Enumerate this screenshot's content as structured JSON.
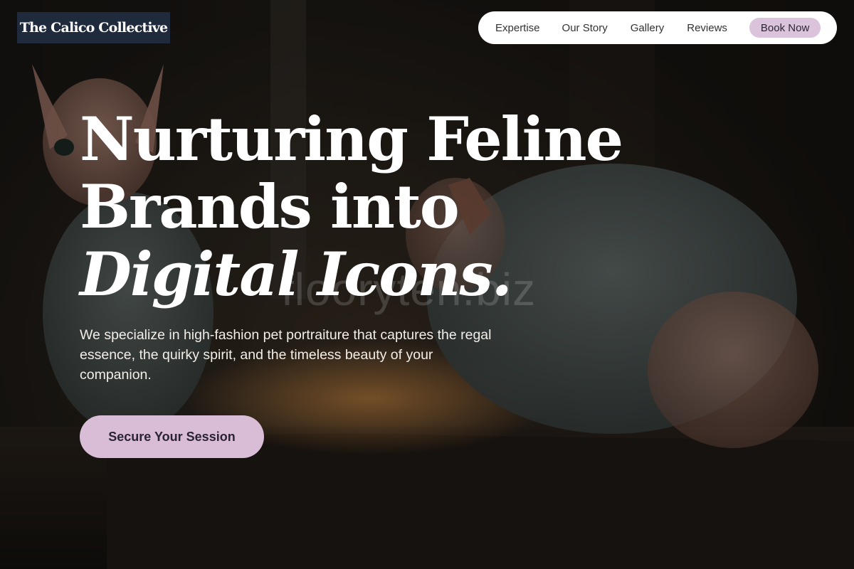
{
  "brand": {
    "logo_text": "The Calico Collective",
    "logo_bg": "#1f2a3c"
  },
  "nav": {
    "links": [
      {
        "label": "Expertise"
      },
      {
        "label": "Our Story"
      },
      {
        "label": "Gallery"
      },
      {
        "label": "Reviews"
      }
    ],
    "cta_label": "Book Now",
    "cta_color": "#dcc3dc"
  },
  "hero": {
    "title_line1": "Nurturing Feline",
    "title_line2": "Brands into",
    "title_line3_italic": "Digital Icons.",
    "subtitle": "We specialize in high-fashion pet portraiture that captures the regal essence, the quirky spirit, and the timeless beauty of your companion.",
    "cta_label": "Secure Your Session",
    "cta_color": "#d9bdd6"
  },
  "watermark": {
    "text": "flooryten.biz"
  },
  "background": {
    "description_icon": "hairless-cats-in-sweaters-photo"
  }
}
